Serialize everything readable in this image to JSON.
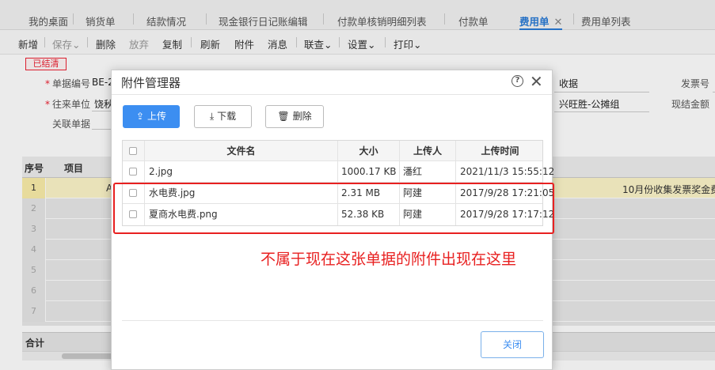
{
  "tabs": [
    {
      "label": "我的桌面"
    },
    {
      "label": "销货单"
    },
    {
      "label": "结款情况"
    },
    {
      "label": "现金银行日记账编辑"
    },
    {
      "label": "付款单核销明细列表"
    },
    {
      "label": "付款单"
    },
    {
      "label": "费用单",
      "active": true,
      "close": "✕"
    },
    {
      "label": "费用单列表"
    }
  ],
  "toolbar": {
    "new": "新增",
    "save": "保存",
    "delete": "删除",
    "discard": "放弃",
    "copy": "复制",
    "refresh": "刷新",
    "attachment": "附件",
    "message": "消息",
    "lookup": "联查",
    "settings": "设置",
    "print": "打印",
    "caret": "⌄"
  },
  "form": {
    "status": "已结清",
    "doc_no_label": "单据编号",
    "doc_no_value": "BE-2",
    "partner_label": "往来单位",
    "partner_value": "饶秋",
    "related_label": "关联单据",
    "receipt_value": "收据",
    "shop_value": "兴旺胜-公摊组",
    "invoice_label": "发票号",
    "cash_label": "现结金额"
  },
  "grid": {
    "headers": {
      "seq": "序号",
      "item": "项目"
    },
    "rows": [
      "1",
      "2",
      "3",
      "4",
      "5",
      "6",
      "7"
    ],
    "row1_fragment": "A",
    "row1_note": "10月份收集发票奖金费用",
    "total_label": "合计"
  },
  "modal": {
    "title": "附件管理器",
    "help": "?",
    "close": "✕",
    "upload": "上传",
    "download": "下载",
    "delete": "删除",
    "columns": {
      "name": "文件名",
      "size": "大小",
      "uploader": "上传人",
      "time": "上传时间"
    },
    "files": [
      {
        "name": "2.jpg",
        "size": "1000.17 KB",
        "uploader": "潘红",
        "time": "2021/11/3 15:55:12"
      },
      {
        "name": "水电费.jpg",
        "size": "2.31 MB",
        "uploader": "阿建",
        "time": "2017/9/28 17:21:05"
      },
      {
        "name": "夏商水电费.png",
        "size": "52.38 KB",
        "uploader": "阿建",
        "time": "2017/9/28 17:17:12"
      }
    ],
    "close_button": "关闭"
  },
  "annotation": {
    "text": "不属于现在这张单据的附件出现在这里",
    "color": "#e82020"
  }
}
